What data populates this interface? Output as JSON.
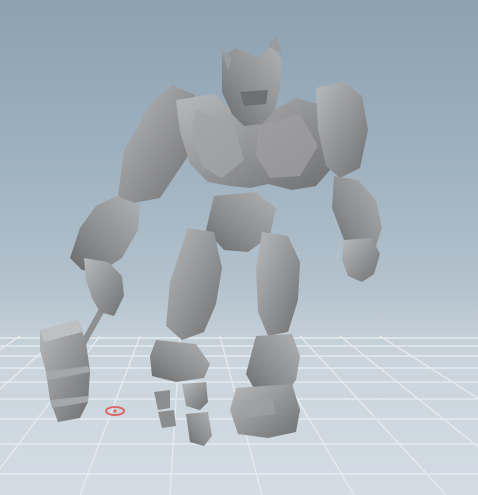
{
  "viewport": {
    "background_top": "#8ea1b1",
    "background_bottom": "#d3dce3",
    "grid_color": "#e3e9ee",
    "model_color": "#8c8d8f",
    "model_highlight": "#b4b5b7",
    "origin_marker_color": "#d86a6a"
  },
  "scene": {
    "object": "robot-golem-model",
    "weapon": "hammer"
  }
}
